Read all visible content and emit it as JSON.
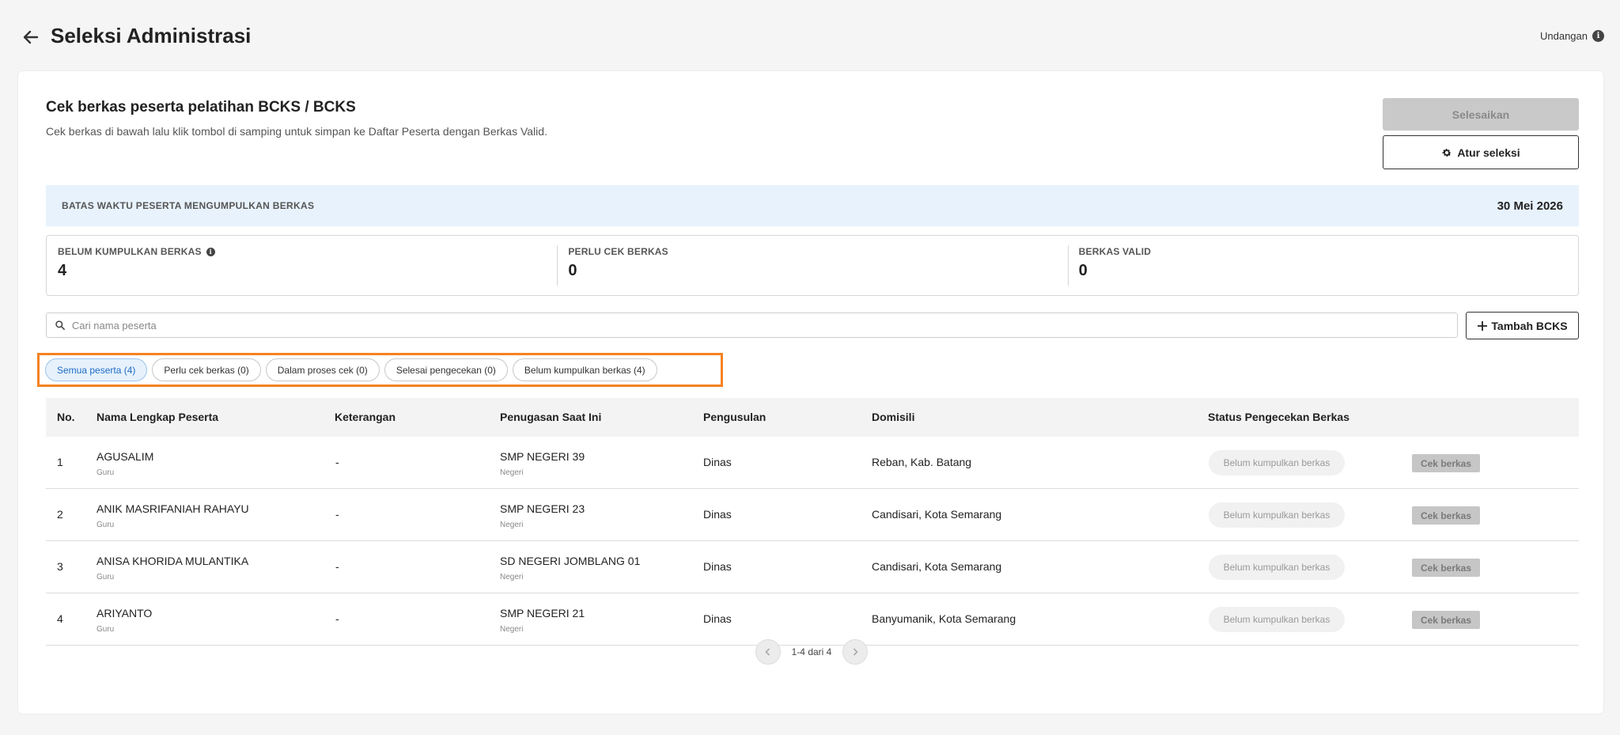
{
  "header": {
    "title": "Seleksi Administrasi",
    "invite_label": "Undangan"
  },
  "card": {
    "title": "Cek berkas peserta pelatihan BCKS / BCKS",
    "subtitle": "Cek berkas di bawah lalu klik tombol di samping untuk simpan ke Daftar Peserta dengan Berkas Valid.",
    "finish_label": "Selesaikan",
    "settings_label": "Atur seleksi"
  },
  "deadline": {
    "label": "BATAS WAKTU PESERTA MENGUMPULKAN BERKAS",
    "date": "30 Mei 2026"
  },
  "stats": [
    {
      "label": "BELUM KUMPULKAN BERKAS",
      "value": "4"
    },
    {
      "label": "PERLU CEK BERKAS",
      "value": "0"
    },
    {
      "label": "BERKAS VALID",
      "value": "0"
    }
  ],
  "search": {
    "placeholder": "Cari nama peserta"
  },
  "add_button_label": "Tambah BCKS",
  "filters": [
    {
      "label": "Semua peserta (4)",
      "active": true
    },
    {
      "label": "Perlu cek berkas (0)",
      "active": false
    },
    {
      "label": "Dalam proses cek (0)",
      "active": false
    },
    {
      "label": "Selesai pengecekan (0)",
      "active": false
    },
    {
      "label": "Belum kumpulkan berkas (4)",
      "active": false
    }
  ],
  "table": {
    "headers": [
      "No.",
      "Nama Lengkap Peserta",
      "Keterangan",
      "Penugasan Saat Ini",
      "Pengusulan",
      "Domisili",
      "Status Pengecekan Berkas"
    ],
    "rows": [
      {
        "no": "1",
        "name": "AGUSALIM",
        "role": "Guru",
        "note": "-",
        "school": "SMP NEGERI 39",
        "school_type": "Negeri",
        "proposal": "Dinas",
        "domicile": "Reban, Kab. Batang",
        "status": "Belum kumpulkan berkas",
        "action": "Cek berkas"
      },
      {
        "no": "2",
        "name": "ANIK MASRIFANIAH RAHAYU",
        "role": "Guru",
        "note": "-",
        "school": "SMP NEGERI 23",
        "school_type": "Negeri",
        "proposal": "Dinas",
        "domicile": "Candisari, Kota Semarang",
        "status": "Belum kumpulkan berkas",
        "action": "Cek berkas"
      },
      {
        "no": "3",
        "name": "ANISA KHORIDA MULANTIKA",
        "role": "Guru",
        "note": "-",
        "school": "SD NEGERI JOMBLANG 01",
        "school_type": "Negeri",
        "proposal": "Dinas",
        "domicile": "Candisari, Kota Semarang",
        "status": "Belum kumpulkan berkas",
        "action": "Cek berkas"
      },
      {
        "no": "4",
        "name": "ARIYANTO",
        "role": "Guru",
        "note": "-",
        "school": "SMP NEGERI 21",
        "school_type": "Negeri",
        "proposal": "Dinas",
        "domicile": "Banyumanik, Kota Semarang",
        "status": "Belum kumpulkan berkas",
        "action": "Cek berkas"
      }
    ]
  },
  "pagination": {
    "text": "1-4 dari 4"
  }
}
